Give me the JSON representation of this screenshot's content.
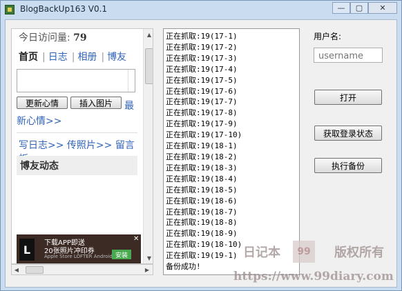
{
  "window": {
    "title": "BlogBackUp163 V0.1",
    "minimize": "—",
    "maximize": "▢",
    "close": "✕"
  },
  "blog": {
    "visits_label": "今日访问量:",
    "visits_count": "79",
    "nav": [
      "首页",
      "日志",
      "相册",
      "博友"
    ],
    "update_button": "更新心情",
    "insert_button": "插入图片",
    "tail_text1": "最",
    "tail_text2": "新心情>>",
    "links": "写日志>> 传照片>> 留言板",
    "friends_heading": "博友动态",
    "ad": {
      "logo": "L",
      "line1": "下载APP即送",
      "line2": "20张照片冲印券",
      "line3": "Apple Store  LOFTER Android App",
      "install": "安装",
      "close": "✕"
    }
  },
  "log": {
    "lines": [
      "正在抓取:19(17-1)",
      "正在抓取:19(17-2)",
      "正在抓取:19(17-3)",
      "正在抓取:19(17-4)",
      "正在抓取:19(17-5)",
      "正在抓取:19(17-6)",
      "正在抓取:19(17-7)",
      "正在抓取:19(17-8)",
      "正在抓取:19(17-9)",
      "正在抓取:19(17-10)",
      "正在抓取:19(18-1)",
      "正在抓取:19(18-2)",
      "正在抓取:19(18-3)",
      "正在抓取:19(18-4)",
      "正在抓取:19(18-5)",
      "正在抓取:19(18-6)",
      "正在抓取:19(18-7)",
      "正在抓取:19(18-8)",
      "正在抓取:19(18-9)",
      "正在抓取:19(18-10)",
      "正在抓取:19(19-1)",
      "备份成功!"
    ]
  },
  "form": {
    "username_label": "用户名:",
    "username_placeholder": "username",
    "open_button": "打开",
    "login_status_button": "获取登录状态",
    "backup_button": "执行备份"
  },
  "watermark": {
    "left": "日记本",
    "seal": "99",
    "right": "版权所有",
    "url": "https://www.99diary.com"
  }
}
